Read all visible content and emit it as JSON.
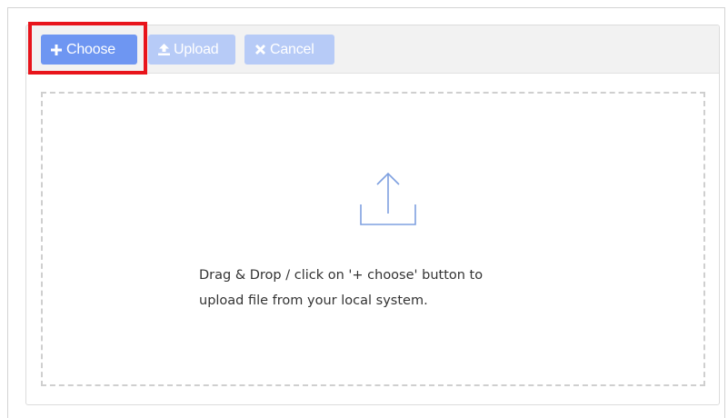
{
  "toolbar": {
    "choose": {
      "icon": "plus-icon",
      "label": "Choose"
    },
    "upload": {
      "icon": "upload-icon",
      "label": "Upload"
    },
    "cancel": {
      "icon": "times-icon",
      "label": "Cancel"
    }
  },
  "drop_zone": {
    "icon": "upload-tray-icon",
    "text_line1": "Drag & Drop / click on '+ choose' button to",
    "text_line2": "upload file from your local system."
  },
  "colors": {
    "primary_button": "#6e96f2",
    "disabled_button": "#b7cbf7",
    "highlight": "#e8141b",
    "icon_stroke": "#7ea0e0"
  }
}
